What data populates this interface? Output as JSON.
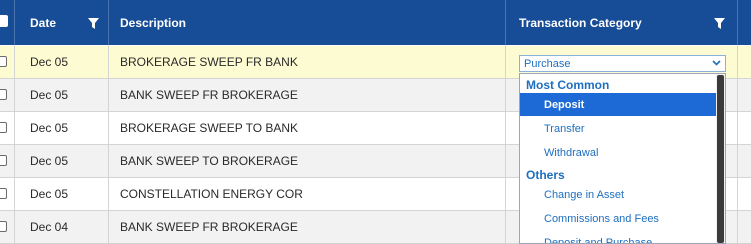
{
  "header": {
    "date_label": "Date",
    "description_label": "Description",
    "category_label": "Transaction Category"
  },
  "rows": [
    {
      "date": "Dec 05",
      "description": "BROKERAGE SWEEP FR BANK"
    },
    {
      "date": "Dec 05",
      "description": "BANK SWEEP FR BROKERAGE"
    },
    {
      "date": "Dec 05",
      "description": "BROKERAGE SWEEP TO BANK"
    },
    {
      "date": "Dec 05",
      "description": "BANK SWEEP TO BROKERAGE"
    },
    {
      "date": "Dec 05",
      "description": "CONSTELLATION ENERGY COR"
    },
    {
      "date": "Dec 04",
      "description": "BANK SWEEP FR BROKERAGE"
    }
  ],
  "category_select": {
    "value": "Purchase"
  },
  "dropdown": {
    "group_most_common": "Most Common",
    "most_common": [
      "Deposit",
      "Transfer",
      "Withdrawal"
    ],
    "group_others": "Others",
    "others": [
      "Change in Asset",
      "Commissions and Fees",
      "Deposit and Purchase"
    ],
    "selected": "Deposit"
  },
  "colors": {
    "header_bg": "#174c96",
    "highlight_row": "#fdfbd2",
    "alt_row": "#f2f2f2",
    "link_blue": "#1e6fbf",
    "selected_bg": "#1d6ad6"
  },
  "icons": {
    "filter": "filter-icon",
    "chevron": "chevron-down-icon"
  }
}
